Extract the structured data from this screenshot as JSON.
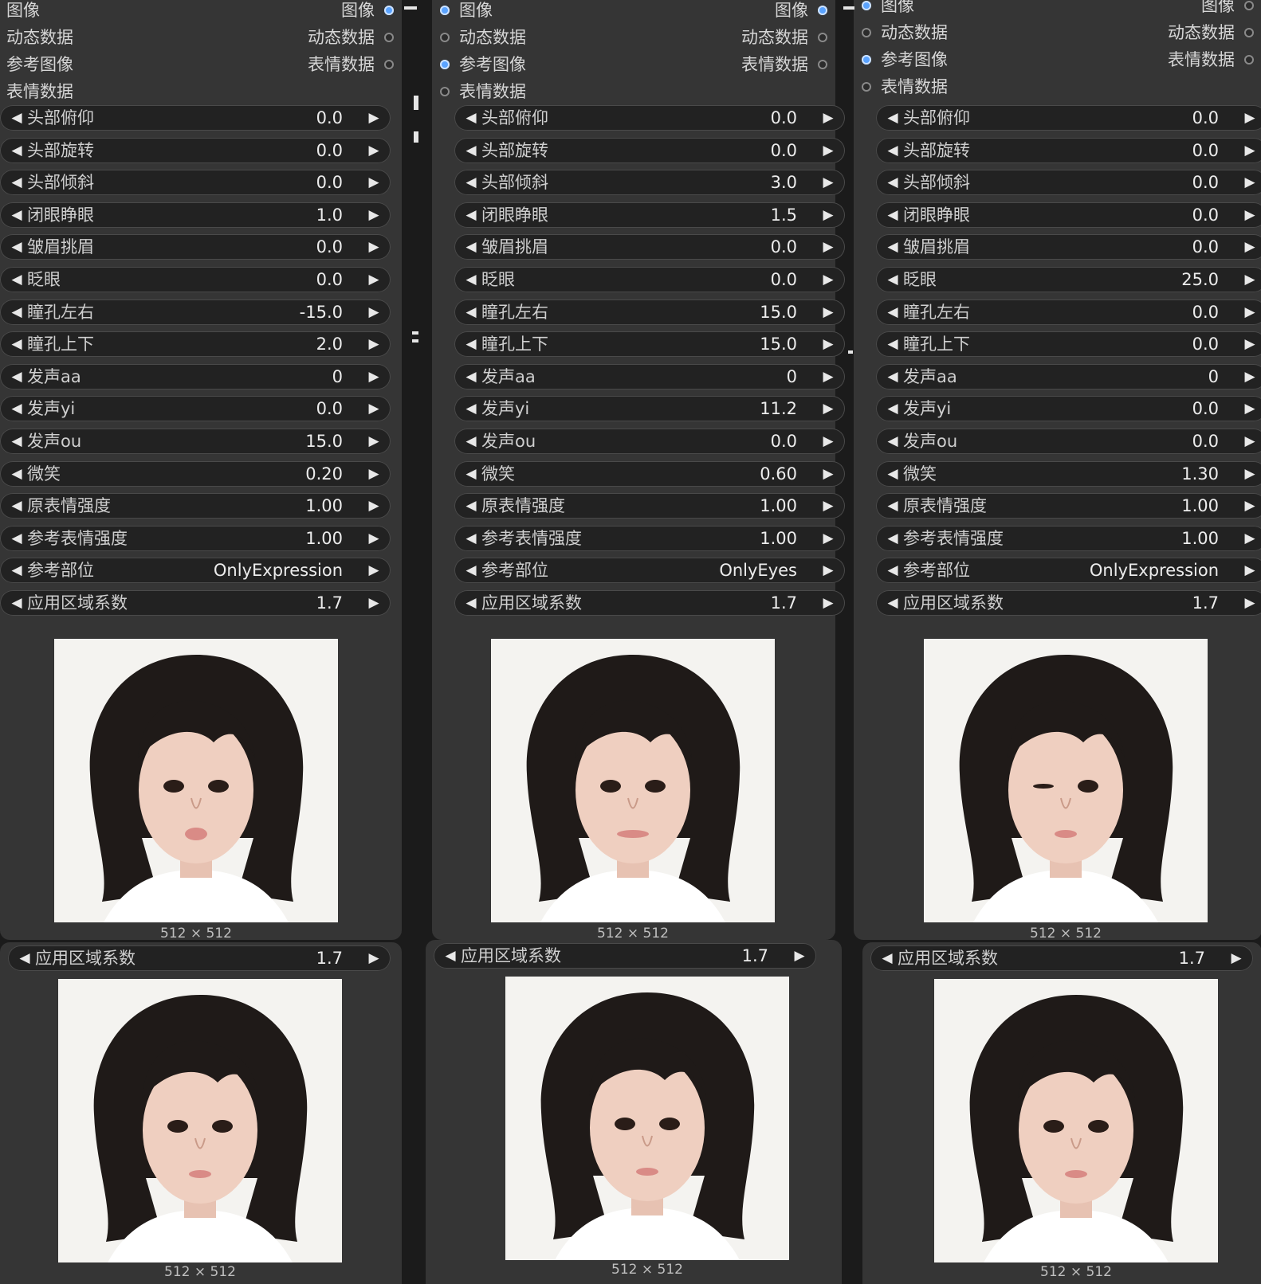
{
  "columns": [
    {
      "inputs": [
        {
          "label": "图像",
          "connected": false
        },
        {
          "label": "动态数据",
          "connected": false
        },
        {
          "label": "参考图像",
          "connected": false
        },
        {
          "label": "表情数据",
          "connected": false
        }
      ],
      "outputs": [
        {
          "label": "图像",
          "connected": true
        },
        {
          "label": "动态数据",
          "connected": false
        },
        {
          "label": "表情数据",
          "connected": false
        }
      ],
      "widgets": [
        {
          "label": "头部俯仰",
          "value": "0.0"
        },
        {
          "label": "头部旋转",
          "value": "0.0"
        },
        {
          "label": "头部倾斜",
          "value": "0.0"
        },
        {
          "label": "闭眼睁眼",
          "value": "1.0"
        },
        {
          "label": "皱眉挑眉",
          "value": "0.0"
        },
        {
          "label": "眨眼",
          "value": "0.0"
        },
        {
          "label": "瞳孔左右",
          "value": "-15.0"
        },
        {
          "label": "瞳孔上下",
          "value": "2.0"
        },
        {
          "label": "发声aa",
          "value": "0"
        },
        {
          "label": "发声yi",
          "value": "0.0"
        },
        {
          "label": "发声ou",
          "value": "15.0"
        },
        {
          "label": "微笑",
          "value": "0.20"
        },
        {
          "label": "原表情强度",
          "value": "1.00"
        },
        {
          "label": "参考表情强度",
          "value": "1.00"
        },
        {
          "label": "参考部位",
          "value": "OnlyExpression"
        },
        {
          "label": "应用区域系数",
          "value": "1.7"
        }
      ],
      "preview_caption": "512 × 512",
      "bottom": {
        "widget": {
          "label": "应用区域系数",
          "value": "1.7"
        },
        "preview_caption": "512 × 512"
      }
    },
    {
      "inputs": [
        {
          "label": "图像",
          "connected": true
        },
        {
          "label": "动态数据",
          "connected": false
        },
        {
          "label": "参考图像",
          "connected": true
        },
        {
          "label": "表情数据",
          "connected": false
        }
      ],
      "outputs": [
        {
          "label": "图像",
          "connected": true
        },
        {
          "label": "动态数据",
          "connected": false
        },
        {
          "label": "表情数据",
          "connected": false
        }
      ],
      "widgets": [
        {
          "label": "头部俯仰",
          "value": "0.0"
        },
        {
          "label": "头部旋转",
          "value": "0.0"
        },
        {
          "label": "头部倾斜",
          "value": "3.0"
        },
        {
          "label": "闭眼睁眼",
          "value": "1.5"
        },
        {
          "label": "皱眉挑眉",
          "value": "0.0"
        },
        {
          "label": "眨眼",
          "value": "0.0"
        },
        {
          "label": "瞳孔左右",
          "value": "15.0"
        },
        {
          "label": "瞳孔上下",
          "value": "15.0"
        },
        {
          "label": "发声aa",
          "value": "0"
        },
        {
          "label": "发声yi",
          "value": "11.2"
        },
        {
          "label": "发声ou",
          "value": "0.0"
        },
        {
          "label": "微笑",
          "value": "0.60"
        },
        {
          "label": "原表情强度",
          "value": "1.00"
        },
        {
          "label": "参考表情强度",
          "value": "1.00"
        },
        {
          "label": "参考部位",
          "value": "OnlyEyes"
        },
        {
          "label": "应用区域系数",
          "value": "1.7"
        }
      ],
      "preview_caption": "512 × 512",
      "bottom": {
        "widget": {
          "label": "应用区域系数",
          "value": "1.7"
        },
        "preview_caption": "512 × 512"
      }
    },
    {
      "inputs": [
        {
          "label": "图像",
          "connected": true
        },
        {
          "label": "动态数据",
          "connected": false
        },
        {
          "label": "参考图像",
          "connected": true
        },
        {
          "label": "表情数据",
          "connected": false
        }
      ],
      "outputs": [
        {
          "label": "图像",
          "connected": false
        },
        {
          "label": "动态数据",
          "connected": false
        },
        {
          "label": "表情数据",
          "connected": false
        }
      ],
      "widgets": [
        {
          "label": "头部俯仰",
          "value": "0.0"
        },
        {
          "label": "头部旋转",
          "value": "0.0"
        },
        {
          "label": "头部倾斜",
          "value": "0.0"
        },
        {
          "label": "闭眼睁眼",
          "value": "0.0"
        },
        {
          "label": "皱眉挑眉",
          "value": "0.0"
        },
        {
          "label": "眨眼",
          "value": "25.0"
        },
        {
          "label": "瞳孔左右",
          "value": "0.0"
        },
        {
          "label": "瞳孔上下",
          "value": "0.0"
        },
        {
          "label": "发声aa",
          "value": "0"
        },
        {
          "label": "发声yi",
          "value": "0.0"
        },
        {
          "label": "发声ou",
          "value": "0.0"
        },
        {
          "label": "微笑",
          "value": "1.30"
        },
        {
          "label": "原表情强度",
          "value": "1.00"
        },
        {
          "label": "参考表情强度",
          "value": "1.00"
        },
        {
          "label": "参考部位",
          "value": "OnlyExpression"
        },
        {
          "label": "应用区域系数",
          "value": "1.7"
        }
      ],
      "preview_caption": "512 × 512",
      "bottom": {
        "widget": {
          "label": "应用区域系数",
          "value": "1.7"
        },
        "preview_caption": "512 × 512"
      }
    }
  ],
  "icons": {
    "left_arrow": "◀",
    "right_arrow": "▶",
    "decrement": "left-arrow-icon",
    "increment": "right-arrow-icon"
  },
  "colors": {
    "canvas": "#1b1b1b",
    "node": "#353535",
    "widget": "#222222",
    "slot_connected": "#5aa3ff"
  }
}
